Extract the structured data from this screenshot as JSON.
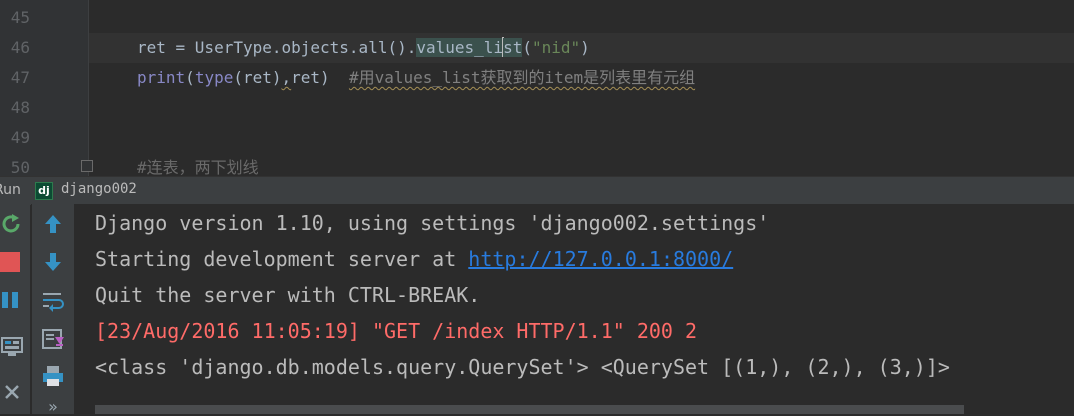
{
  "editor": {
    "line_numbers": [
      "45",
      "46",
      "47",
      "48",
      "49",
      "50"
    ],
    "line46": {
      "p1": "ret = UserType.objects.all().",
      "p2": "values_li",
      "p3": "st",
      "p4": "(",
      "p5": "\"nid\"",
      "p6": ")"
    },
    "line47": {
      "p1": "print",
      "p2": "(",
      "p3": "type",
      "p4": "(ret)",
      "p5": ",",
      "p6": "ret)  ",
      "p7": "#用values_list获取到的item是列表里有元组"
    },
    "line50": "#连表，两下划线"
  },
  "run_tab": {
    "panel_label": "Run",
    "icon_text": "dj",
    "config_name": "django002"
  },
  "toolbar": {
    "left": [
      "rerun-icon",
      "stop-icon",
      "pause-icon",
      "layout-icon",
      "close-icon"
    ],
    "right": [
      "up-arrow-icon",
      "down-arrow-icon",
      "soft-wrap-icon",
      "scroll-to-end-icon",
      "print-icon",
      "more-icon"
    ],
    "more_label": "»"
  },
  "console": {
    "line1": "Django version 1.10, using settings 'django002.settings'",
    "line2_prefix": "Starting development server at ",
    "line2_link": "http://127.0.0.1:8000/",
    "line3": "Quit the server with CTRL-BREAK.",
    "line4": "[23/Aug/2016 11:05:19] \"GET /index HTTP/1.1\" 200 2",
    "line5": "<class 'django.db.models.query.QuerySet'> <QuerySet [(1,), (2,), (3,)]>"
  },
  "colors": {
    "editor_bg": "#2b2b2b",
    "gutter_bg": "#313335",
    "panel_bg": "#3c3f41",
    "text": "#a9b7c6",
    "string": "#6a8759",
    "builtin": "#8888c6",
    "error_red": "#ff6b68",
    "link_blue": "#287bde",
    "django_green": "#0c4b33"
  }
}
